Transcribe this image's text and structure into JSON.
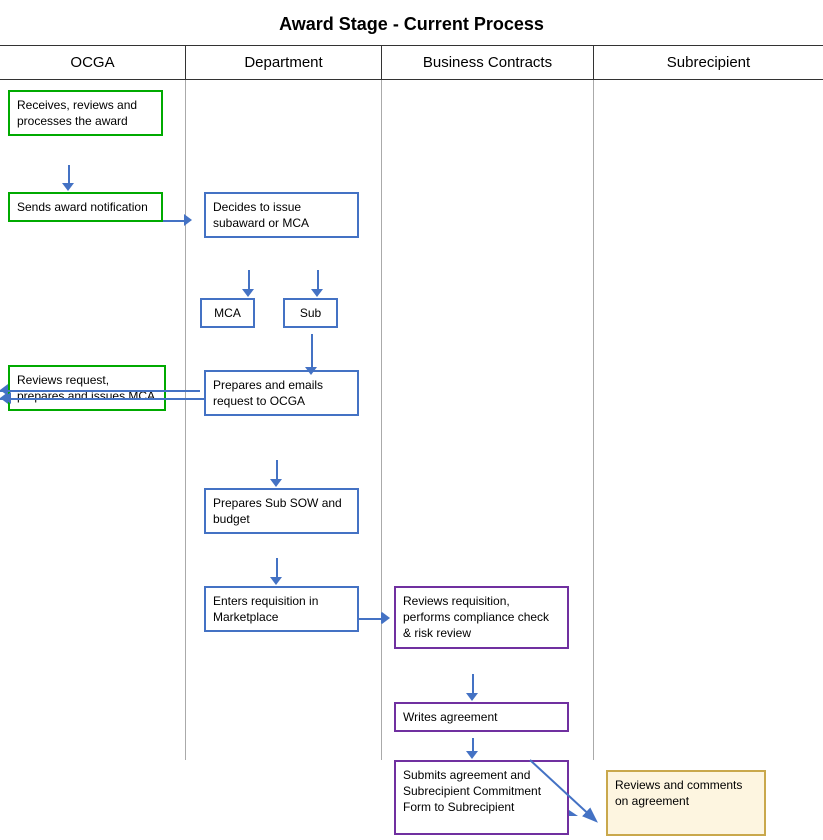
{
  "title": "Award Stage - Current Process",
  "headers": {
    "ocga": "OCGA",
    "department": "Department",
    "business_contracts": "Business Contracts",
    "subrecipient": "Subrecipient"
  },
  "boxes": {
    "receives_reviews": "Receives, reviews and processes the award",
    "sends_award": "Sends award notification",
    "reviews_request": "Reviews request, prepares and issues MCA",
    "decides_issue": "Decides to issue subaward or MCA",
    "mca": "MCA",
    "sub": "Sub",
    "prepares_emails": "Prepares and emails request to OCGA",
    "prepares_sow": "Prepares Sub SOW and budget",
    "enters_requisition": "Enters requisition in Marketplace",
    "reviews_requisition": "Reviews requisition, performs compliance check & risk review",
    "writes_agreement": "Writes agreement",
    "submits_agreement": "Submits agreement and Subrecipient Commitment Form to Subrecipient",
    "reviews_comments": "Reviews and comments on agreement"
  }
}
